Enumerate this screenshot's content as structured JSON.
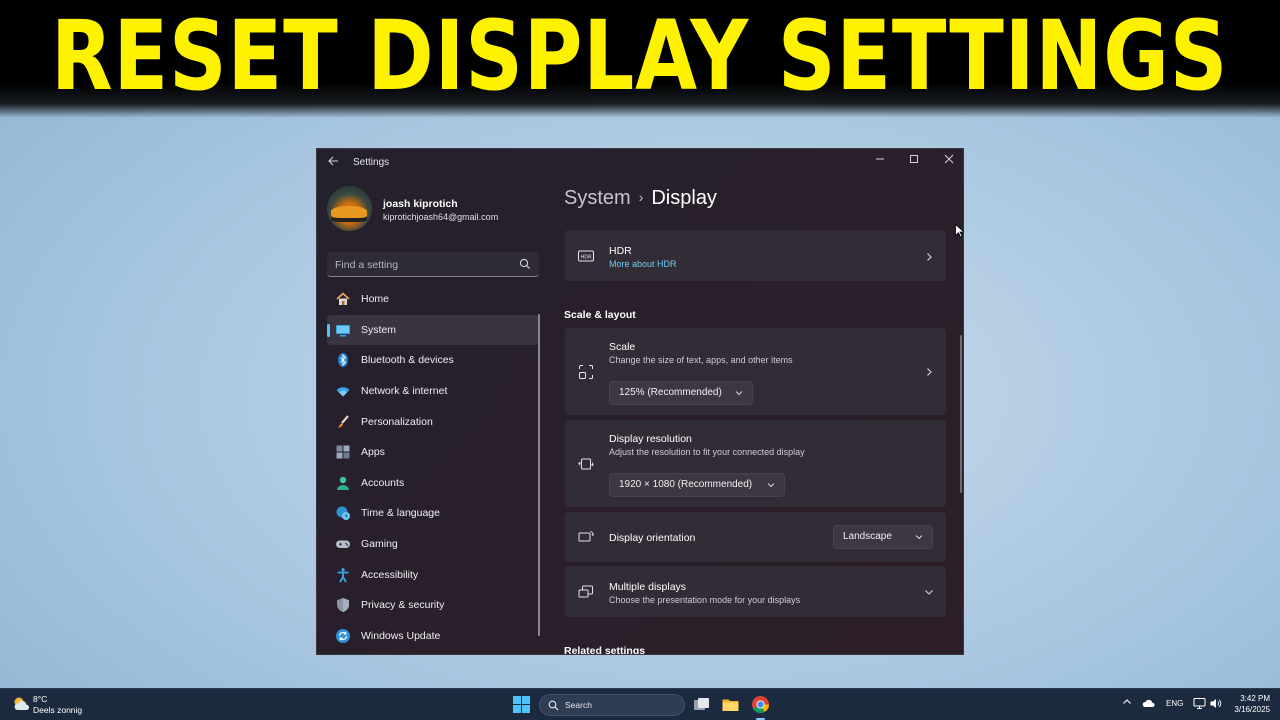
{
  "headline": "RESET DISPLAY SETTINGS",
  "window": {
    "title": "Settings",
    "user": {
      "name": "joash kiprotich",
      "email": "kiprotichjoash64@gmail.com"
    },
    "search": {
      "placeholder": "Find a setting"
    },
    "nav": [
      {
        "label": "Home",
        "icon": "home-icon",
        "active": false
      },
      {
        "label": "System",
        "icon": "system-icon",
        "active": true
      },
      {
        "label": "Bluetooth & devices",
        "icon": "bluetooth-icon",
        "active": false
      },
      {
        "label": "Network & internet",
        "icon": "wifi-icon",
        "active": false
      },
      {
        "label": "Personalization",
        "icon": "brush-icon",
        "active": false
      },
      {
        "label": "Apps",
        "icon": "apps-icon",
        "active": false
      },
      {
        "label": "Accounts",
        "icon": "person-icon",
        "active": false
      },
      {
        "label": "Time & language",
        "icon": "globe-clock-icon",
        "active": false
      },
      {
        "label": "Gaming",
        "icon": "gamepad-icon",
        "active": false
      },
      {
        "label": "Accessibility",
        "icon": "accessibility-icon",
        "active": false
      },
      {
        "label": "Privacy & security",
        "icon": "shield-icon",
        "active": false
      },
      {
        "label": "Windows Update",
        "icon": "update-icon",
        "active": false
      }
    ],
    "breadcrumb": {
      "parent": "System",
      "separator": "›",
      "current": "Display"
    },
    "hdr": {
      "title": "HDR",
      "link": "More about HDR"
    },
    "section_scale_layout": "Scale & layout",
    "scale": {
      "title": "Scale",
      "subtitle": "Change the size of text, apps, and other items",
      "value": "125% (Recommended)"
    },
    "resolution": {
      "title": "Display resolution",
      "subtitle": "Adjust the resolution to fit your connected display",
      "value": "1920 × 1080 (Recommended)"
    },
    "orientation": {
      "title": "Display orientation",
      "value": "Landscape"
    },
    "multiple": {
      "title": "Multiple displays",
      "subtitle": "Choose the presentation mode for your displays"
    },
    "section_related": "Related settings"
  },
  "taskbar": {
    "weather": {
      "temp": "8°C",
      "condition": "Deels zonnig"
    },
    "search_label": "Search",
    "language": "ENG",
    "time": "3:42 PM",
    "date": "3/16/2025"
  },
  "colors": {
    "headline": "#fff200",
    "accent": "#4fc3f7",
    "link": "#6fcdf2"
  }
}
